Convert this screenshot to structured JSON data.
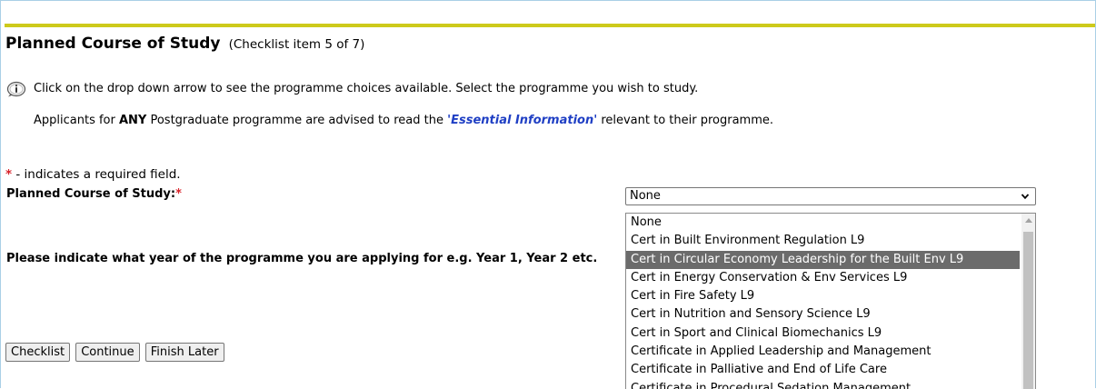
{
  "header": {
    "title": "Planned Course of Study",
    "subtitle": "(Checklist item 5 of 7)"
  },
  "info": {
    "instruction": "Click on the drop down arrow to see the programme choices available. Select the programme you wish to study.",
    "pg_prefix": "Applicants for ",
    "pg_any": "ANY",
    "pg_middle": " Postgraduate programme are advised to read the ",
    "pg_link": "'Essential Information'",
    "pg_suffix": " relevant to their programme."
  },
  "form": {
    "required_star": "*",
    "required_note": " - indicates a required field.",
    "course_label": "Planned Course of Study:",
    "course_selected": "None",
    "year_label": "Please indicate what year of the programme you are applying for e.g. Year 1, Year 2 etc."
  },
  "dropdown": {
    "options": [
      "None",
      "Cert in Built Environment Regulation L9",
      "Cert in Circular Economy Leadership for the Built Env L9",
      "Cert in Energy Conservation & Env Services L9",
      "Cert in Fire Safety L9",
      "Cert in Nutrition and Sensory Science L9",
      "Cert in Sport and Clinical Biomechanics L9",
      "Certificate in Applied Leadership and Management",
      "Certificate in Palliative and End of Life Care",
      "Certificate in Procedural Sedation Management"
    ],
    "highlighted_index": 2
  },
  "buttons": {
    "checklist": "Checklist",
    "continue": "Continue",
    "finish_later": "Finish Later"
  },
  "colors": {
    "accent_bar": "#cdca1b",
    "required": "#d8232a",
    "link": "#1f3fc4",
    "highlight": "#6b6b6b"
  },
  "icons": {
    "info": "info-icon",
    "select_arrow": "chevron-down-icon"
  }
}
